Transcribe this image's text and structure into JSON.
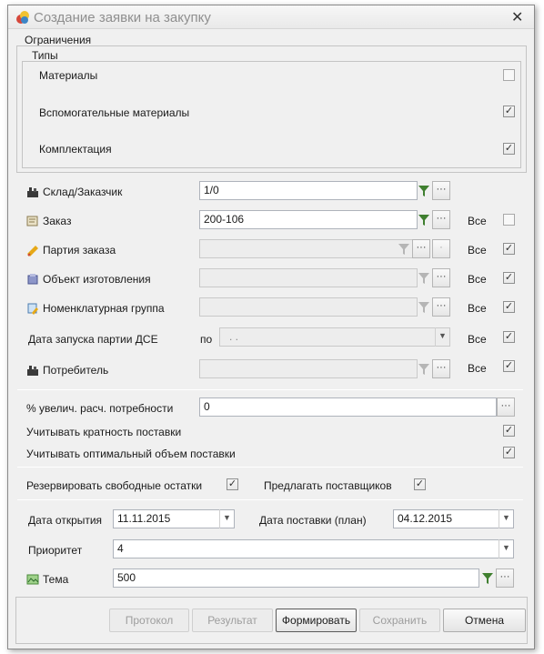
{
  "window": {
    "title": "Создание заявки на закупку"
  },
  "limits": {
    "title": "Ограничения",
    "types": {
      "title": "Типы",
      "items": [
        {
          "label": "Материалы",
          "checked": false
        },
        {
          "label": "Вспомогательные материалы",
          "checked": true
        },
        {
          "label": "Комплектация",
          "checked": true
        }
      ]
    }
  },
  "fields": {
    "warehouse": {
      "label": "Склад/Заказчик",
      "value": "1/0"
    },
    "order": {
      "label": "Заказ",
      "value": "200-106",
      "all_label": "Все",
      "all_checked": false
    },
    "batch": {
      "label": "Партия заказа",
      "value": "",
      "all_label": "Все",
      "all_checked": true
    },
    "object": {
      "label": "Объект изготовления",
      "value": "",
      "all_label": "Все",
      "all_checked": true
    },
    "nomen_group": {
      "label": "Номенклатурная группа",
      "value": "",
      "all_label": "Все",
      "all_checked": true
    },
    "launch_date": {
      "label": "Дата запуска партии ДСЕ",
      "by_label": "по",
      "value": ". .",
      "all_label": "Все",
      "all_checked": true
    },
    "consumer": {
      "label": "Потребитель",
      "value": "",
      "all_label": "Все",
      "all_checked": true
    }
  },
  "needs": {
    "increase_label": "% увелич. расч. потребности",
    "increase_value": "0",
    "multiplicity_label": "Учитывать кратность поставки",
    "multiplicity_checked": true,
    "optimal_label": "Учитывать оптимальный объем поставки",
    "optimal_checked": true
  },
  "options": {
    "reserve_label": "Резервировать свободные остатки",
    "reserve_checked": true,
    "suggest_label": "Предлагать поставщиков",
    "suggest_checked": true
  },
  "dates": {
    "open_label": "Дата открытия",
    "open_value": "11.11.2015",
    "delivery_label": "Дата поставки (план)",
    "delivery_value": "04.12.2015"
  },
  "priority": {
    "label": "Приоритет",
    "value": "4"
  },
  "theme": {
    "label": "Тема",
    "value": "500"
  },
  "buttons": {
    "protocol": "Протокол",
    "result": "Результат",
    "form": "Формировать",
    "save": "Сохранить",
    "cancel": "Отмена"
  },
  "glyphs": {
    "check": "✓",
    "ellipsis": "···",
    "dropdown": "▼",
    "close": "✕",
    "dot": "·"
  }
}
